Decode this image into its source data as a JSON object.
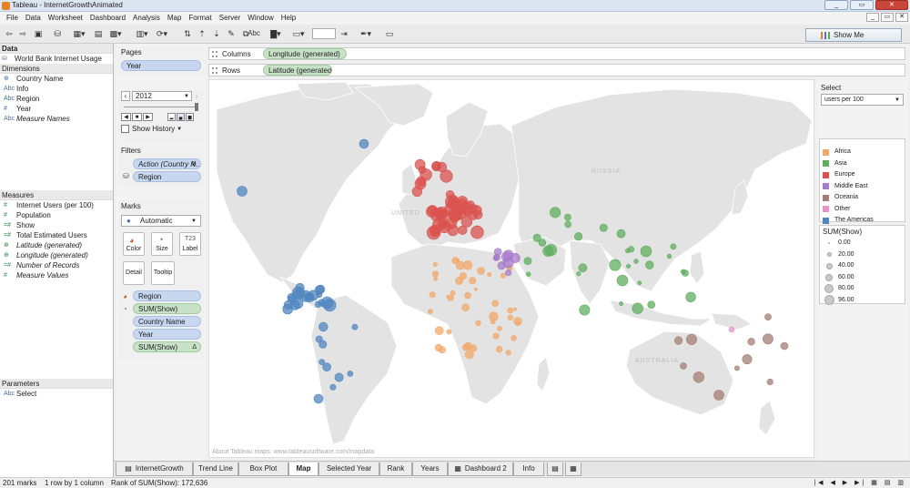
{
  "window": {
    "title": "Tableau - InternetGrowthAnimated"
  },
  "menu": [
    "File",
    "Data",
    "Worksheet",
    "Dashboard",
    "Analysis",
    "Map",
    "Format",
    "Server",
    "Window",
    "Help"
  ],
  "toolbar": {
    "abc_label": "Abc",
    "show_me": "Show Me"
  },
  "data_pane": {
    "header": "Data",
    "datasource": "World Bank Internet Usage",
    "dimensions_header": "Dimensions",
    "dimensions": [
      {
        "icon": "globe",
        "label": "Country Name"
      },
      {
        "icon": "Abc",
        "label": "Info"
      },
      {
        "icon": "Abc",
        "label": "Region"
      },
      {
        "icon": "#",
        "label": "Year"
      },
      {
        "icon": "Abc",
        "label": "Measure Names",
        "italic": true
      }
    ],
    "measures_header": "Measures",
    "measures": [
      {
        "icon": "#",
        "label": "Internet Users (per 100)"
      },
      {
        "icon": "#",
        "label": "Population"
      },
      {
        "icon": "=#",
        "label": "Show"
      },
      {
        "icon": "=#",
        "label": "Total Estimated Users"
      },
      {
        "icon": "globe",
        "label": "Latitude (generated)",
        "italic": true
      },
      {
        "icon": "globe",
        "label": "Longitude (generated)",
        "italic": true
      },
      {
        "icon": "=#",
        "label": "Number of Records",
        "italic": true
      },
      {
        "icon": "#",
        "label": "Measure Values",
        "italic": true
      }
    ],
    "parameters_header": "Parameters",
    "parameters": [
      {
        "icon": "Abc",
        "label": "Select"
      }
    ]
  },
  "pages": {
    "header": "Pages",
    "pill": "Year",
    "current_value": "2012",
    "show_history": "Show History"
  },
  "filters": {
    "header": "Filters",
    "pills": [
      "Action (Country N...",
      "Region"
    ]
  },
  "marks": {
    "header": "Marks",
    "type": "Automatic",
    "buttons": [
      "Color",
      "Size",
      "Label",
      "Detail",
      "Tooltip"
    ],
    "pills": [
      {
        "label": "Region",
        "color": "blue"
      },
      {
        "label": "SUM(Show)",
        "color": "green"
      },
      {
        "label": "Country Name",
        "color": "blue"
      },
      {
        "label": "Year",
        "color": "blue"
      },
      {
        "label": "SUM(Show)",
        "color": "green"
      }
    ]
  },
  "shelves": {
    "columns_label": "Columns",
    "columns_pill": "Longitude (generated)",
    "rows_label": "Rows",
    "rows_pill": "Latitude (generated)"
  },
  "map": {
    "attribution": "About Tableau maps: www.tableausoftware.com/mapdata",
    "place_labels": [
      "RUSSIA",
      "UNITED",
      "AUSTRALIA"
    ]
  },
  "select_parameter": {
    "header": "Select",
    "value": "users per 100"
  },
  "color_legend": {
    "items": [
      {
        "label": "Africa",
        "color": "#f2a86a"
      },
      {
        "label": "Asia",
        "color": "#5fae5f"
      },
      {
        "label": "Europe",
        "color": "#d9534f"
      },
      {
        "label": "Middle East",
        "color": "#a57bc9"
      },
      {
        "label": "Oceania",
        "color": "#a47f73"
      },
      {
        "label": "Other",
        "color": "#e793c9"
      },
      {
        "label": "The Americas",
        "color": "#4f86bf"
      }
    ]
  },
  "size_legend": {
    "header": "SUM(Show)",
    "values": [
      "0.00",
      "20.00",
      "40.00",
      "60.00",
      "80.00",
      "96.00"
    ]
  },
  "sheet_tabs": [
    "InternetGrowth",
    "Trend Line",
    "Box Plot",
    "Map",
    "Selected Year",
    "Rank",
    "Years",
    "Dashboard 2",
    "Info"
  ],
  "active_tab": "Map",
  "status": {
    "marks": "201 marks",
    "dims": "1 row by 1 column",
    "sum": "Rank of SUM(Show): 172,636"
  }
}
